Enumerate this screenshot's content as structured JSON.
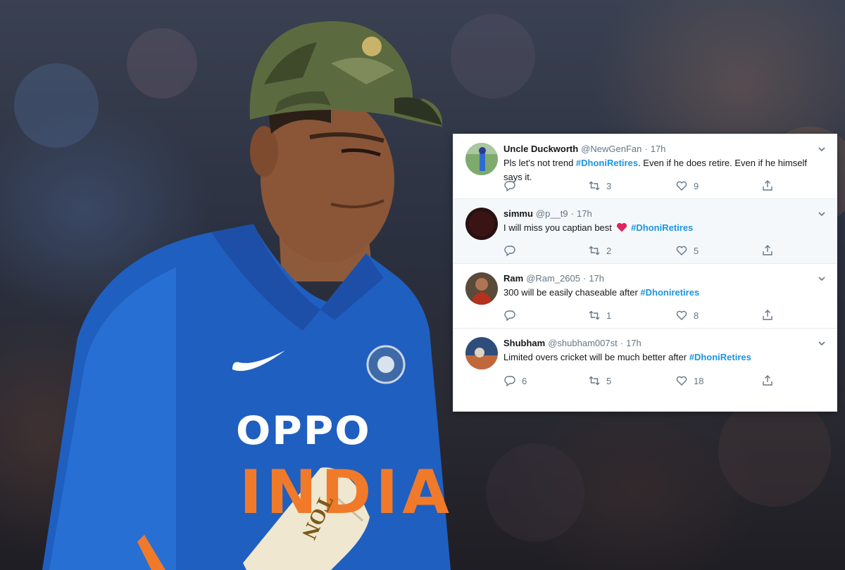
{
  "photo": {
    "shirt_sponsor": "OPPO",
    "shirt_country": "INDIA",
    "bat_text": "TON"
  },
  "tweets": [
    {
      "name": "Uncle Duckworth",
      "handle": "@NewGenFan",
      "time": "17h",
      "text_before": "Pls let's not trend ",
      "hashtag": "#DhoniRetires",
      "text_after": ". Even if he does retire. Even if he himself says it.",
      "replies": "",
      "retweets": "3",
      "likes": "9"
    },
    {
      "name": "simmu",
      "handle": "@p__t9",
      "time": "17h",
      "text_before": "I will miss you captian best",
      "emoji": "red-heart",
      "hashtag": "#DhoniRetires",
      "text_after": "",
      "replies": "",
      "retweets": "2",
      "likes": "5"
    },
    {
      "name": "Ram",
      "handle": "@Ram_2605",
      "time": "17h",
      "text_before": "300 will be easily chaseable after ",
      "hashtag": "#Dhoniretires",
      "text_after": "",
      "replies": "",
      "retweets": "1",
      "likes": "8"
    },
    {
      "name": "Shubham",
      "handle": "@shubham007st",
      "time": "17h",
      "text_before": "Limited overs cricket will be much better after ",
      "hashtag": "#DhoniRetires",
      "text_after": "",
      "replies": "6",
      "retweets": "5",
      "likes": "18"
    }
  ],
  "colors": {
    "link": "#1b95e0",
    "text": "#14171a",
    "meta": "#657786",
    "heart": "#e0245e"
  },
  "icons": [
    "reply-icon",
    "retweet-icon",
    "like-icon",
    "share-icon",
    "chevron-down-icon",
    "red-heart-emoji"
  ]
}
